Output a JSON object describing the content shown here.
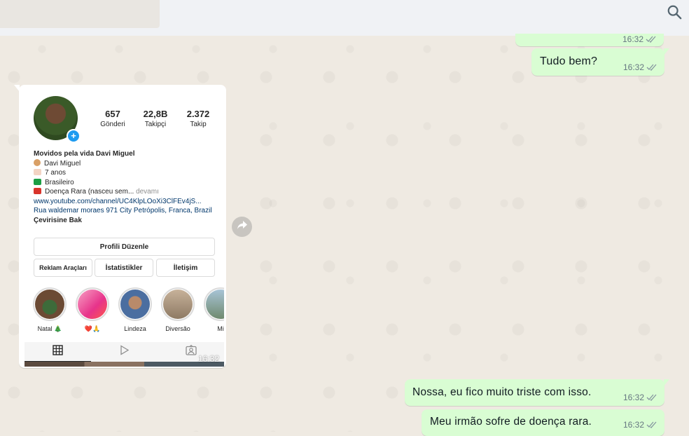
{
  "search": {
    "icon": "search-icon"
  },
  "messages": [
    {
      "text": "",
      "time": "16:32",
      "status": "read"
    },
    {
      "text": "Tudo bem?",
      "time": "16:32",
      "status": "read"
    },
    {
      "text": "Nossa, eu fico muito triste com isso.",
      "time": "16:32",
      "status": "read"
    },
    {
      "text": "Meu irmão sofre de doença rara.",
      "time": "16:32",
      "status": "read"
    }
  ],
  "image_message": {
    "time": "16:32",
    "profile": {
      "stats": [
        {
          "value": "657",
          "label": "Gönderi"
        },
        {
          "value": "22,8B",
          "label": "Takipçi"
        },
        {
          "value": "2.372",
          "label": "Takip"
        }
      ],
      "name": "Movidos pela vida Davi Miguel",
      "bio_lines": [
        "Davi Miguel",
        "7 anos",
        "Brasileiro"
      ],
      "bio_disease": "Doença Rara (nasceu sem...",
      "bio_more": "devamı",
      "link": "www.youtube.com/channel/UC4KlpLOoXi3ClFEv4jS...",
      "address": "Rua waldemar moraes 971 City Petrópolis, Franca, Brazil",
      "translate": "Çevirisine Bak",
      "edit_profile": "Profili Düzenle",
      "buttons": [
        "Reklam Araçları",
        "İstatistikler",
        "İletişim"
      ],
      "highlights": [
        "Natal 🎄",
        "❤️🙏",
        "Lindeza",
        "Diversão",
        "Mi"
      ]
    }
  },
  "colors": {
    "outgoing": "#d9fdd3",
    "background": "#efeae2",
    "read_tick": "#53bdeb"
  }
}
